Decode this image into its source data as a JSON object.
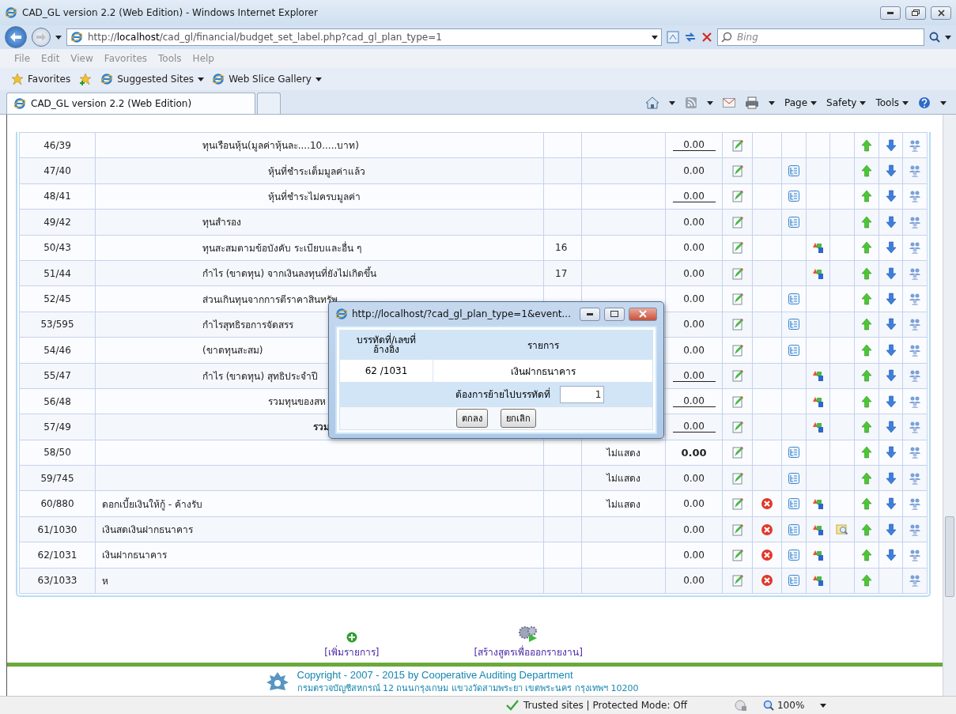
{
  "window": {
    "title": "CAD_GL version 2.2 (Web Edition) - Windows Internet Explorer"
  },
  "address_bar": {
    "value": "http://**localhost**/cad_gl/financial/budget_set_label.php?cad_gl_plan_type=1"
  },
  "search": {
    "placeholder": "Bing"
  },
  "menu": [
    {
      "label": "File",
      "disabled": true
    },
    {
      "label": "Edit",
      "disabled": true
    },
    {
      "label": "View",
      "disabled": true
    },
    {
      "label": "Favorites",
      "disabled": true
    },
    {
      "label": "Tools",
      "disabled": true
    },
    {
      "label": "Help",
      "disabled": true
    }
  ],
  "favorites_bar": {
    "label": "Favorites",
    "links": [
      "Suggested Sites",
      "Web Slice Gallery"
    ]
  },
  "tabs": [
    {
      "label": "CAD_GL version 2.2 (Web Edition)",
      "selected": true
    },
    {
      "selected": false
    }
  ],
  "command_bar": [
    "Page",
    "Safety",
    "Tools"
  ],
  "rows": [
    {
      "no": "46/39",
      "name": "ทุนเรือนหุ้น(มูลค่าหุ้นละ....10.....บาท)",
      "kind": "group",
      "column_3": "",
      "column_4": "",
      "amount": {
        "value": "0.00",
        "kind": "underlined"
      },
      "actions": [
        {
          "kind": "edit"
        },
        {
          "kind": "up"
        },
        {
          "kind": "down"
        },
        {
          "kind": "link"
        }
      ]
    },
    {
      "no": "47/40",
      "name": "หุ้นที่ชำระเต็มมูลค่าแล้ว",
      "kind": "item",
      "column_3": "",
      "column_4": "",
      "amount": {
        "value": "0.00",
        "kind": "plain"
      },
      "actions": [
        {
          "kind": "edit"
        },
        {
          "kind": "tree"
        },
        {
          "kind": "up"
        },
        {
          "kind": "down"
        },
        {
          "kind": "link"
        }
      ]
    },
    {
      "no": "48/41",
      "name": "หุ้นที่ชำระไม่ครบมูลค่า",
      "kind": "item",
      "column_3": "",
      "column_4": "",
      "amount": {
        "value": "0.00",
        "kind": "underlined"
      },
      "actions": [
        {
          "kind": "edit"
        },
        {
          "kind": "tree"
        },
        {
          "kind": "up"
        },
        {
          "kind": "down"
        },
        {
          "kind": "link"
        }
      ]
    },
    {
      "no": "49/42",
      "name": "ทุนสำรอง",
      "kind": "group",
      "column_3": "",
      "column_4": "",
      "amount": {
        "value": "0.00",
        "kind": "plain"
      },
      "actions": [
        {
          "kind": "edit"
        },
        {
          "kind": "tree"
        },
        {
          "kind": "up"
        },
        {
          "kind": "down"
        },
        {
          "kind": "link"
        }
      ]
    },
    {
      "no": "50/43",
      "name": "ทุนสะสมตามข้อบังคับ ระเบียบและอื่น ๆ",
      "kind": "group",
      "column_3": "16",
      "column_4": "",
      "amount": {
        "value": "0.00",
        "kind": "plain"
      },
      "actions": [
        {
          "kind": "edit"
        },
        {
          "kind": "shapes"
        },
        {
          "kind": "up"
        },
        {
          "kind": "down"
        },
        {
          "kind": "link"
        }
      ]
    },
    {
      "no": "51/44",
      "name": "กำไร (ขาดทุน) จากเงินลงทุนที่ยังไม่เกิดขึ้น",
      "kind": "group",
      "column_3": "17",
      "column_4": "",
      "amount": {
        "value": "0.00",
        "kind": "plain"
      },
      "actions": [
        {
          "kind": "edit"
        },
        {
          "kind": "shapes"
        },
        {
          "kind": "up"
        },
        {
          "kind": "down"
        },
        {
          "kind": "link"
        }
      ]
    },
    {
      "no": "52/45",
      "name": "ส่วนเกินทุนจากการตีราคาสินทรัพ",
      "kind": "group",
      "column_3": "",
      "column_4": "",
      "amount": {
        "value": "0.00",
        "kind": "plain"
      },
      "actions": [
        {
          "kind": "edit"
        },
        {
          "kind": "tree"
        },
        {
          "kind": "up"
        },
        {
          "kind": "down"
        },
        {
          "kind": "link"
        }
      ]
    },
    {
      "no": "53/595",
      "name": "กำไรสุทธิรอการจัดสรร",
      "kind": "group",
      "column_3": "",
      "column_4": "",
      "amount": {
        "value": "0.00",
        "kind": "plain"
      },
      "actions": [
        {
          "kind": "edit"
        },
        {
          "kind": "tree"
        },
        {
          "kind": "up"
        },
        {
          "kind": "down"
        },
        {
          "kind": "link"
        }
      ]
    },
    {
      "no": "54/46",
      "name": "(ขาดทุนสะสม)",
      "kind": "group",
      "column_3": "",
      "column_4": "",
      "amount": {
        "value": "0.00",
        "kind": "plain"
      },
      "actions": [
        {
          "kind": "edit"
        },
        {
          "kind": "tree"
        },
        {
          "kind": "up"
        },
        {
          "kind": "down"
        },
        {
          "kind": "link"
        }
      ]
    },
    {
      "no": "55/47",
      "name": "กำไร (ขาดทุน) สุทธิประจำปี",
      "kind": "group",
      "column_3": "",
      "column_4": "",
      "amount": {
        "value": "0.00",
        "kind": "underlined"
      },
      "actions": [
        {
          "kind": "edit"
        },
        {
          "kind": "shapes"
        },
        {
          "kind": "up"
        },
        {
          "kind": "down"
        },
        {
          "kind": "link"
        }
      ]
    },
    {
      "no": "56/48",
      "name": "รวมทุนของสห",
      "kind": "item",
      "column_3": "",
      "column_4": "",
      "amount": {
        "value": "0.00",
        "kind": "underlined"
      },
      "actions": [
        {
          "kind": "edit"
        },
        {
          "kind": "shapes"
        },
        {
          "kind": "up"
        },
        {
          "kind": "down"
        },
        {
          "kind": "link"
        }
      ]
    },
    {
      "no": "57/49",
      "name": "รวม",
      "kind": "total",
      "column_3": "",
      "column_4": "",
      "amount": {
        "value": "0.00",
        "kind": "underlined"
      },
      "actions": [
        {
          "kind": "edit"
        },
        {
          "kind": "shapes"
        },
        {
          "kind": "up"
        },
        {
          "kind": "down"
        },
        {
          "kind": "link"
        }
      ]
    },
    {
      "no": "58/50",
      "name": "",
      "kind": "top",
      "column_3": "",
      "column_4": "ไม่แสดง",
      "amount": {
        "value": "0.00",
        "kind": "bold"
      },
      "actions": [
        {
          "kind": "edit"
        },
        {
          "kind": "tree"
        },
        {
          "kind": "up"
        },
        {
          "kind": "down"
        },
        {
          "kind": "link"
        }
      ]
    },
    {
      "no": "59/745",
      "name": "",
      "kind": "top",
      "column_3": "",
      "column_4": "ไม่แสดง",
      "amount": {
        "value": "0.00",
        "kind": "plain"
      },
      "actions": [
        {
          "kind": "edit"
        },
        {
          "kind": "tree"
        },
        {
          "kind": "up"
        },
        {
          "kind": "down"
        },
        {
          "kind": "link"
        }
      ]
    },
    {
      "no": "60/880",
      "name": "ดอกเบี้ยเงินให้กู้ - ค้างรับ",
      "kind": "top",
      "column_3": "",
      "column_4": "ไม่แสดง",
      "amount": {
        "value": "0.00",
        "kind": "plain"
      },
      "actions": [
        {
          "kind": "edit"
        },
        {
          "kind": "delete"
        },
        {
          "kind": "tree"
        },
        {
          "kind": "shapes"
        },
        {
          "kind": "up"
        },
        {
          "kind": "down"
        },
        {
          "kind": "link"
        }
      ]
    },
    {
      "no": "61/1030",
      "name": "เงินสดเงินฝากธนาคาร",
      "kind": "top",
      "column_3": "",
      "column_4": "",
      "amount": {
        "value": "0.00",
        "kind": "plain"
      },
      "actions": [
        {
          "kind": "edit"
        },
        {
          "kind": "delete"
        },
        {
          "kind": "tree"
        },
        {
          "kind": "shapes"
        },
        {
          "kind": "find"
        },
        {
          "kind": "up"
        },
        {
          "kind": "down"
        },
        {
          "kind": "link"
        }
      ]
    },
    {
      "no": "62/1031",
      "name": "เงินฝากธนาคาร",
      "kind": "top",
      "column_3": "",
      "column_4": "",
      "amount": {
        "value": "0.00",
        "kind": "plain"
      },
      "actions": [
        {
          "kind": "edit"
        },
        {
          "kind": "delete"
        },
        {
          "kind": "tree"
        },
        {
          "kind": "shapes"
        },
        {
          "kind": "up"
        },
        {
          "kind": "down"
        },
        {
          "kind": "link"
        }
      ]
    },
    {
      "no": "63/1033",
      "name": "ห",
      "kind": "top",
      "column_3": "",
      "column_4": "",
      "amount": {
        "value": "0.00",
        "kind": "plain"
      },
      "actions": [
        {
          "kind": "edit"
        },
        {
          "kind": "delete"
        },
        {
          "kind": "tree"
        },
        {
          "kind": "shapes"
        },
        {
          "kind": "up"
        },
        {
          "kind": "link"
        }
      ]
    }
  ],
  "page_links": [
    {
      "kind": "add",
      "label": "[เพิ่มรายการ]"
    },
    {
      "kind": "formula",
      "label": "[สร้างสูตรเพื่อออกรายงาน]"
    }
  ],
  "footer": {
    "copyright": "Copyright - 2007 - 2015 by Cooperative Auditing Department",
    "address": "กรมตรวจบัญชีสหกรณ์ 12 ถนนกรุงเกษม แขวงวัดสามพระยา เขตพระนคร กรุงเทพฯ 10200"
  },
  "dialog": {
    "title": "http://localhost/?cad_gl_plan_type=1&event...",
    "columns": [
      "บรรทัดที่/เลขที่อ้างอิง",
      "รายการ"
    ],
    "row": [
      "62 /1031",
      "เงินฝากธนาคาร"
    ],
    "move_label": "ต้องการย้ายไปบรรทัดที่",
    "move_value": "1",
    "buttons": [
      "ตกลง",
      "ยกเลิก"
    ]
  },
  "status_bar": {
    "zone": "Trusted sites | Protected Mode: Off",
    "zoom": "100%"
  }
}
